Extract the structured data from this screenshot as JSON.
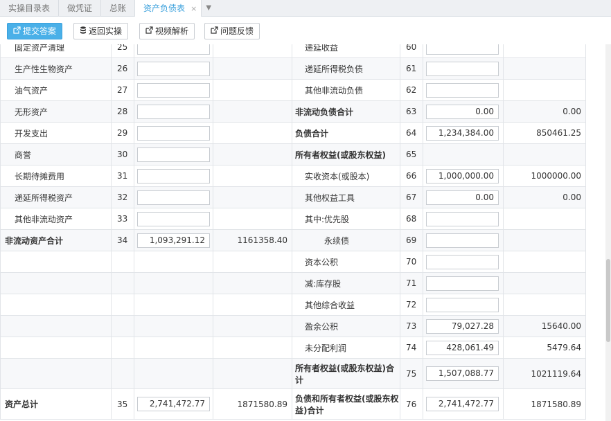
{
  "tabs": [
    {
      "label": "实操目录表"
    },
    {
      "label": "做凭证"
    },
    {
      "label": "总账"
    },
    {
      "label": "资产负债表",
      "active": true
    }
  ],
  "tab_close": "×",
  "tab_more": "▼",
  "toolbar": {
    "submit_label": "提交答案",
    "back_label": "返回实操",
    "video_label": "视频解析",
    "feedback_label": "问题反馈"
  },
  "colors": {
    "accent": "#3aa0dc",
    "primary_button": "#4ab0e8"
  },
  "rows": [
    {
      "l_name": "固定资产清理",
      "l_no": "25",
      "l_end": "",
      "l_prev": "",
      "r_name": "递延收益",
      "r_no": "60",
      "r_end": "",
      "r_prev": ""
    },
    {
      "l_name": "生产性生物资产",
      "l_no": "26",
      "l_end": "",
      "l_prev": "",
      "r_name": "递延所得税负债",
      "r_no": "61",
      "r_end": "",
      "r_prev": ""
    },
    {
      "l_name": "油气资产",
      "l_no": "27",
      "l_end": "",
      "l_prev": "",
      "r_name": "其他非流动负债",
      "r_no": "62",
      "r_end": "",
      "r_prev": ""
    },
    {
      "l_name": "无形资产",
      "l_no": "28",
      "l_end": "",
      "l_prev": "",
      "r_name": "非流动负债合计",
      "r_no": "63",
      "r_end": "0.00",
      "r_prev": "0.00"
    },
    {
      "l_name": "开发支出",
      "l_no": "29",
      "l_end": "",
      "l_prev": "",
      "r_name": "负债合计",
      "r_no": "64",
      "r_end": "1,234,384.00",
      "r_prev": "850461.25"
    },
    {
      "l_name": "商誉",
      "l_no": "30",
      "l_end": "",
      "l_prev": "",
      "r_name": "所有者权益(或股东权益)",
      "r_no": "65",
      "r_end": null,
      "r_prev": ""
    },
    {
      "l_name": "长期待摊费用",
      "l_no": "31",
      "l_end": "",
      "l_prev": "",
      "r_name": "实收资本(或股本)",
      "r_no": "66",
      "r_end": "1,000,000.00",
      "r_prev": "1000000.00"
    },
    {
      "l_name": "递延所得税资产",
      "l_no": "32",
      "l_end": "",
      "l_prev": "",
      "r_name": "其他权益工具",
      "r_no": "67",
      "r_end": "0.00",
      "r_prev": "0.00"
    },
    {
      "l_name": "其他非流动资产",
      "l_no": "33",
      "l_end": "",
      "l_prev": "",
      "r_name": "其中:优先股",
      "r_no": "68",
      "r_end": "",
      "r_prev": ""
    },
    {
      "l_name": "非流动资产合计",
      "l_no": "34",
      "l_end": "1,093,291.12",
      "l_prev": "1161358.40",
      "r_name": "永续债",
      "r_no": "69",
      "r_end": "",
      "r_prev": ""
    },
    {
      "l_name": "",
      "l_no": "",
      "l_end": null,
      "l_prev": "",
      "r_name": "资本公积",
      "r_no": "70",
      "r_end": "",
      "r_prev": ""
    },
    {
      "l_name": "",
      "l_no": "",
      "l_end": null,
      "l_prev": "",
      "r_name": "减:库存股",
      "r_no": "71",
      "r_end": "",
      "r_prev": ""
    },
    {
      "l_name": "",
      "l_no": "",
      "l_end": null,
      "l_prev": "",
      "r_name": "其他综合收益",
      "r_no": "72",
      "r_end": "",
      "r_prev": ""
    },
    {
      "l_name": "",
      "l_no": "",
      "l_end": null,
      "l_prev": "",
      "r_name": "盈余公积",
      "r_no": "73",
      "r_end": "79,027.28",
      "r_prev": "15640.00"
    },
    {
      "l_name": "",
      "l_no": "",
      "l_end": null,
      "l_prev": "",
      "r_name": "未分配利润",
      "r_no": "74",
      "r_end": "428,061.49",
      "r_prev": "5479.64"
    },
    {
      "l_name": "",
      "l_no": "",
      "l_end": null,
      "l_prev": "",
      "r_name": "所有者权益(或股东权益)合计",
      "r_no": "75",
      "r_end": "1,507,088.77",
      "r_prev": "1021119.64"
    },
    {
      "l_name": "资产总计",
      "l_no": "35",
      "l_end": "2,741,472.77",
      "l_prev": "1871580.89",
      "r_name": "负债和所有者权益(或股东权益)合计",
      "r_no": "76",
      "r_end": "2,741,472.77",
      "r_prev": "1871580.89"
    }
  ]
}
